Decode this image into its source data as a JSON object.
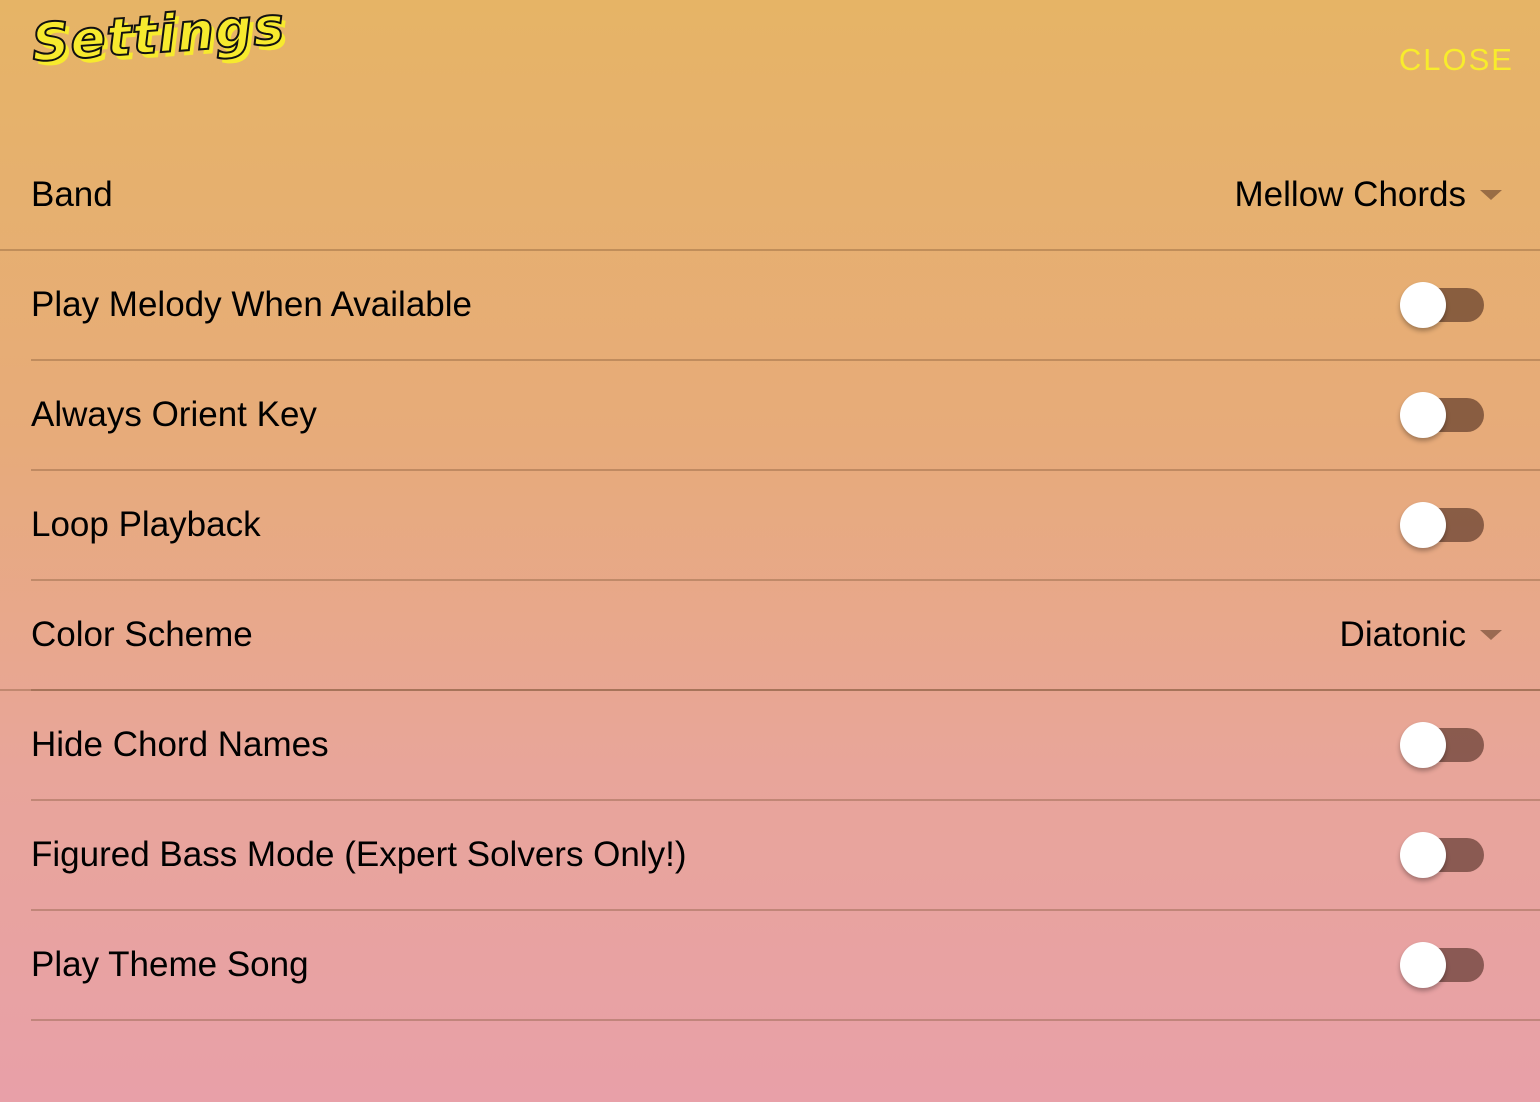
{
  "header": {
    "title": "Settings",
    "close_label": "CLOSE"
  },
  "colors": {
    "accent": "#f8ec2c",
    "background_top": "#e6b466",
    "background_bottom": "#e8a0a8"
  },
  "settings": [
    {
      "label": "Band",
      "type": "select",
      "value": "Mellow Chords"
    },
    {
      "label": "Play Melody When Available",
      "type": "toggle",
      "on": false
    },
    {
      "label": "Always Orient Key",
      "type": "toggle",
      "on": false
    },
    {
      "label": "Loop Playback",
      "type": "toggle",
      "on": false
    },
    {
      "label": "Color Scheme",
      "type": "select",
      "value": "Diatonic"
    },
    {
      "label": "Hide Chord Names",
      "type": "toggle",
      "on": false
    },
    {
      "label": "Figured Bass Mode (Expert Solvers Only!)",
      "type": "toggle",
      "on": false
    },
    {
      "label": "Play Theme Song",
      "type": "toggle",
      "on": false
    }
  ]
}
